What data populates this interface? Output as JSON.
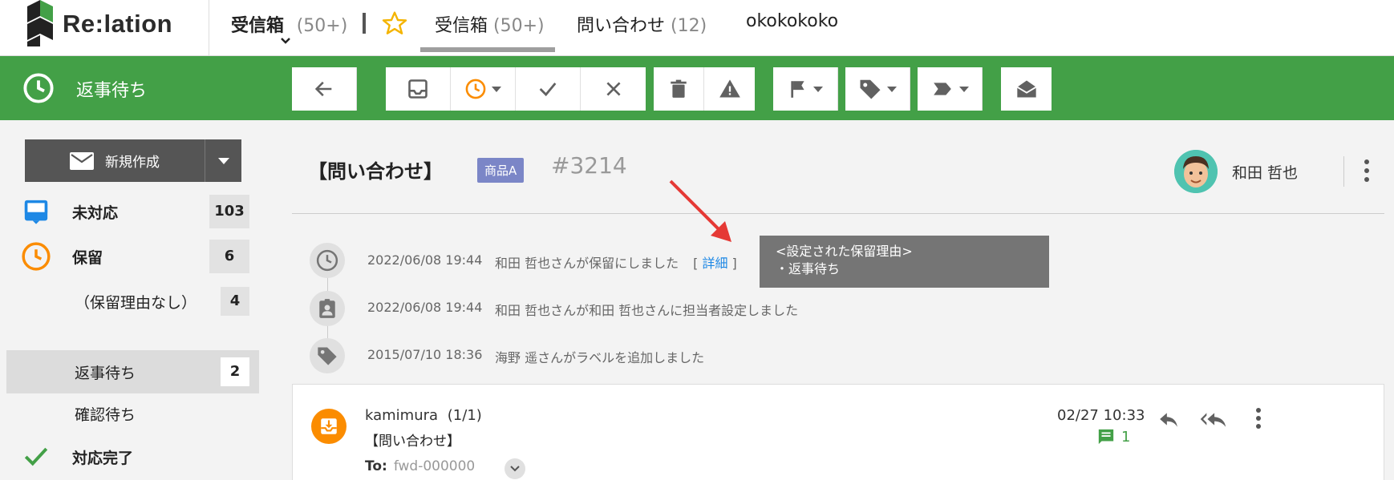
{
  "app": {
    "logo_text": "Re:lation"
  },
  "top_nav": {
    "inbox_main": {
      "label": "受信箱",
      "count": "(50+)"
    },
    "inbox_tab": {
      "label": "受信箱",
      "count": "(50+)"
    },
    "inquiry_tab": {
      "label": "問い合わせ",
      "count": "(12)"
    },
    "custom_tab": {
      "label": "okokokoko"
    }
  },
  "toolbar": {
    "status_title": "返事待ち"
  },
  "sidebar": {
    "new_button": "新規作成",
    "items": [
      {
        "label": "未対応",
        "count": "103"
      },
      {
        "label": "保留",
        "count": "6"
      },
      {
        "label": "（保留理由なし）",
        "count": "4"
      },
      {
        "label": "返事待ち",
        "count": "2"
      },
      {
        "label": "確認待ち",
        "count": ""
      },
      {
        "label": "対応完了",
        "count": ""
      }
    ]
  },
  "ticket": {
    "subject": "【問い合わせ】",
    "tag": "商品A",
    "number": "#3214",
    "assignee": "和田 哲也"
  },
  "timeline": [
    {
      "date": "2022/06/08 19:44",
      "text": "和田 哲也さんが保留にしました",
      "link_open": "[",
      "link_text": "詳細",
      "link_close": "]"
    },
    {
      "date": "2022/06/08 19:44",
      "text": "和田 哲也さんが和田 哲也さんに担当者設定しました"
    },
    {
      "date": "2015/07/10 18:36",
      "text": "海野 遥さんがラベルを追加しました"
    }
  ],
  "tooltip": {
    "line1": "<設定された保留理由>",
    "line2": "・返事待ち"
  },
  "message": {
    "from": "kamimura",
    "thread_count": "(1/1)",
    "subject": "【問い合わせ】",
    "to_label": "To:",
    "to_address": "fwd-000000",
    "time": "02/27 10:33",
    "comment_count": "1"
  },
  "colors": {
    "green": "#43a047",
    "orange": "#fb8c00",
    "blue": "#1e88e5",
    "tag": "#7b86c7"
  }
}
